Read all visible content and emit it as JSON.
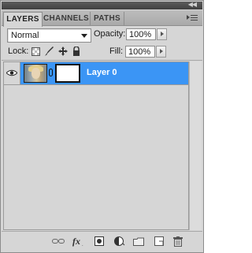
{
  "tabs": [
    {
      "label": "LAYERS",
      "active": true
    },
    {
      "label": "CHANNELS",
      "active": false
    },
    {
      "label": "PATHS",
      "active": false
    }
  ],
  "blend_mode": {
    "value": "Normal"
  },
  "opacity": {
    "label": "Opacity:",
    "value": "100%"
  },
  "lock": {
    "label": "Lock:"
  },
  "fill": {
    "label": "Fill:",
    "value": "100%"
  },
  "layers": [
    {
      "name": "Layer 0",
      "visible": true,
      "selected": true,
      "has_mask": true
    }
  ],
  "colors": {
    "selection": "#3b95f5",
    "panel": "#d6d6d6"
  },
  "bottom_icons": [
    "link-layers-icon",
    "fx-icon",
    "add-mask-icon",
    "adjustment-layer-icon",
    "new-group-icon",
    "new-layer-icon",
    "trash-icon"
  ]
}
